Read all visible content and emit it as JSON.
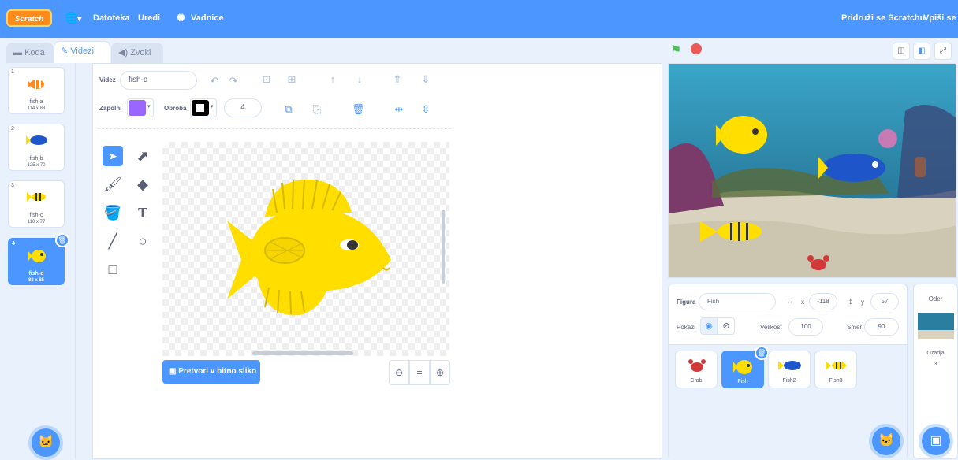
{
  "menu": {
    "logo": "Scratch",
    "globe": "🌐",
    "file": "Datoteka",
    "edit": "Uredi",
    "tutorials": "Vadnice",
    "join": "Pridruži se Scratchu",
    "signin": "Vpiši se"
  },
  "tabs": {
    "code": "Koda",
    "costumes": "Videzi",
    "sounds": "Zvoki"
  },
  "costumes": [
    {
      "num": "1",
      "name": "fish-a",
      "size": "114 x 88"
    },
    {
      "num": "2",
      "name": "fish-b",
      "size": "125 x 70"
    },
    {
      "num": "3",
      "name": "fish-c",
      "size": "110 x 77"
    },
    {
      "num": "4",
      "name": "fish-d",
      "size": "88 x 85"
    }
  ],
  "editor": {
    "costume_label": "Videz",
    "costume_name": "fish-d",
    "fill_label": "Zapolni",
    "outline_label": "Obroba",
    "outline_width": "4",
    "convert_button": "Pretvori v bitno sliko",
    "fill_color": "#9966ff",
    "outline_color": "#000000"
  },
  "sprite_info": {
    "sprite_label": "Figura",
    "sprite_name": "Fish",
    "x_label": "x",
    "x_value": "-118",
    "y_label": "y",
    "y_value": "57",
    "show_label": "Pokaži",
    "size_label": "Velikost",
    "size_value": "100",
    "direction_label": "Smer",
    "direction_value": "90"
  },
  "sprites": [
    {
      "name": "Crab"
    },
    {
      "name": "Fish"
    },
    {
      "name": "Fish2"
    },
    {
      "name": "Fish3"
    }
  ],
  "stage_panel": {
    "title": "Oder",
    "backdrops_label": "Ozadja",
    "backdrops_count": "3"
  },
  "colors": {
    "accent": "#4c97ff",
    "fish_yellow": "#ffde00",
    "fish_dark_yellow": "#d4b900"
  }
}
